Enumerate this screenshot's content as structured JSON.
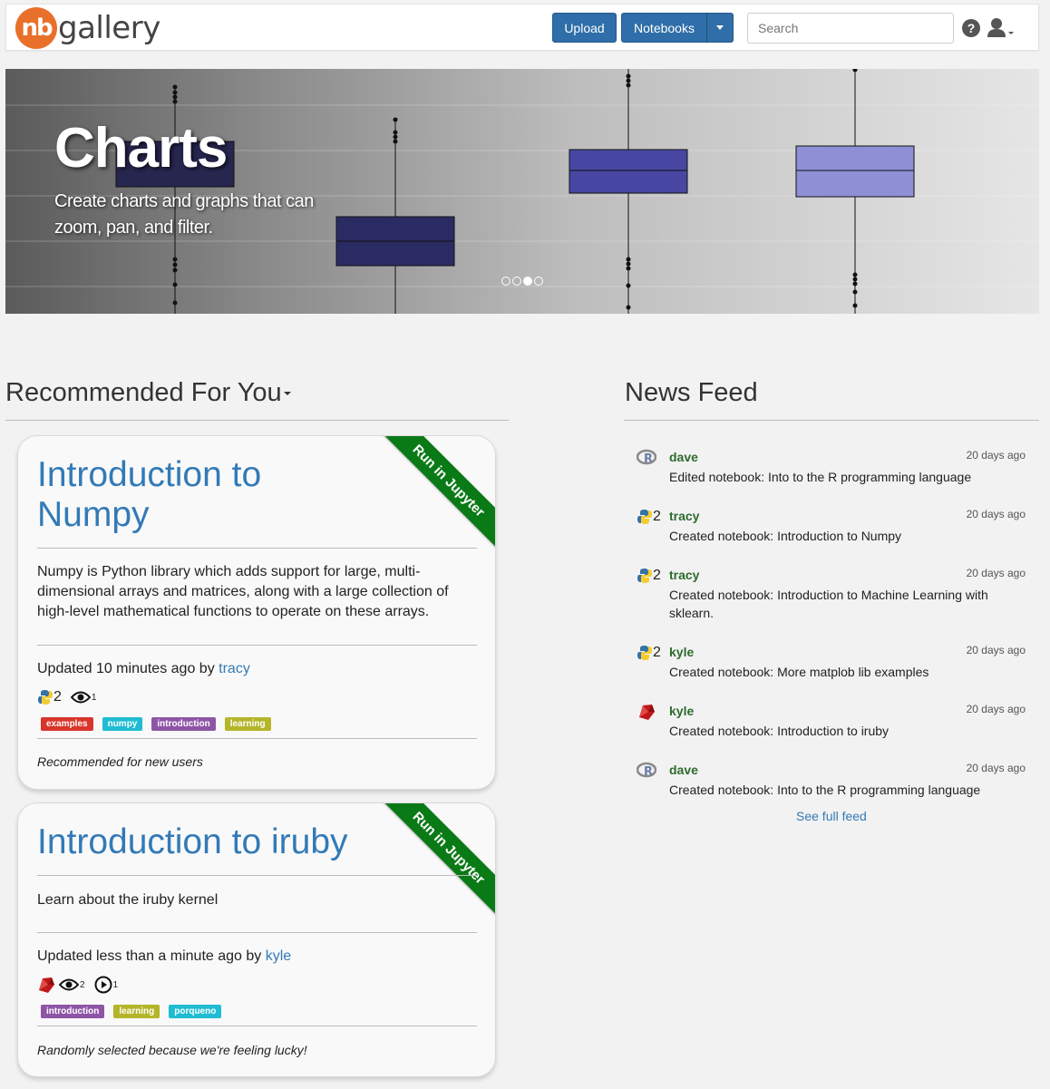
{
  "nav": {
    "brand_logo": "nb",
    "brand_text": "gallery",
    "upload_label": "Upload",
    "notebooks_label": "Notebooks",
    "search_placeholder": "Search",
    "help_glyph": "?"
  },
  "carousel": {
    "title": "Charts",
    "caption": "Create charts and graphs that can zoom, pan, and filter.",
    "slide_count": 4,
    "active_slide": 3
  },
  "recommended": {
    "heading": "Recommended For You",
    "cards": [
      {
        "title": "Introduction to Numpy",
        "ribbon": "Run in Jupyter",
        "description": "Numpy is Python library which adds support for large, multi-dimensional arrays and matrices, along with a large collection of high-level mathematical functions to operate on these arrays.",
        "updated_prefix": "Updated 10 minutes ago by ",
        "author": "tracy",
        "lang_version": "2",
        "views": "1",
        "tags": [
          {
            "label": "examples",
            "color": "#d9352b"
          },
          {
            "label": "numpy",
            "color": "#1fbcd2"
          },
          {
            "label": "introduction",
            "color": "#8e55a6"
          },
          {
            "label": "learning",
            "color": "#b5b52a"
          }
        ],
        "note": "Recommended for new users"
      },
      {
        "title": "Introduction to iruby",
        "ribbon": "Run in Jupyter",
        "description": "Learn about the iruby kernel",
        "updated_prefix": "Updated less than a minute ago by ",
        "author": "kyle",
        "views": "2",
        "runs": "1",
        "tags": [
          {
            "label": "introduction",
            "color": "#8e55a6"
          },
          {
            "label": "learning",
            "color": "#b5b52a"
          },
          {
            "label": "porqueno",
            "color": "#1fbcd2"
          }
        ],
        "note": "Randomly selected because we're feeling lucky!"
      }
    ]
  },
  "news": {
    "heading": "News Feed",
    "items": [
      {
        "icon": "r-icon",
        "user": "dave",
        "time": "20 days ago",
        "text": "Edited notebook: Into to the R programming language"
      },
      {
        "icon": "python-icon",
        "version": "2",
        "user": "tracy",
        "time": "20 days ago",
        "text": "Created notebook: Introduction to Numpy"
      },
      {
        "icon": "python-icon",
        "version": "2",
        "user": "tracy",
        "time": "20 days ago",
        "text": "Created notebook: Introduction to Machine Learning with sklearn."
      },
      {
        "icon": "python-icon",
        "version": "2",
        "user": "kyle",
        "time": "20 days ago",
        "text": "Created notebook: More matplob lib examples"
      },
      {
        "icon": "ruby-icon",
        "user": "kyle",
        "time": "20 days ago",
        "text": "Created notebook: Introduction to iruby"
      },
      {
        "icon": "r-icon",
        "user": "dave",
        "time": "20 days ago",
        "text": "Created notebook: Into to the R programming language"
      }
    ],
    "see_full": "See full feed"
  },
  "colors": {
    "brand": "#e8702a",
    "primary": "#2f6ea8",
    "link": "#337ab7",
    "ribbon": "#0a7a16",
    "feed_user": "#2e6b2e"
  }
}
